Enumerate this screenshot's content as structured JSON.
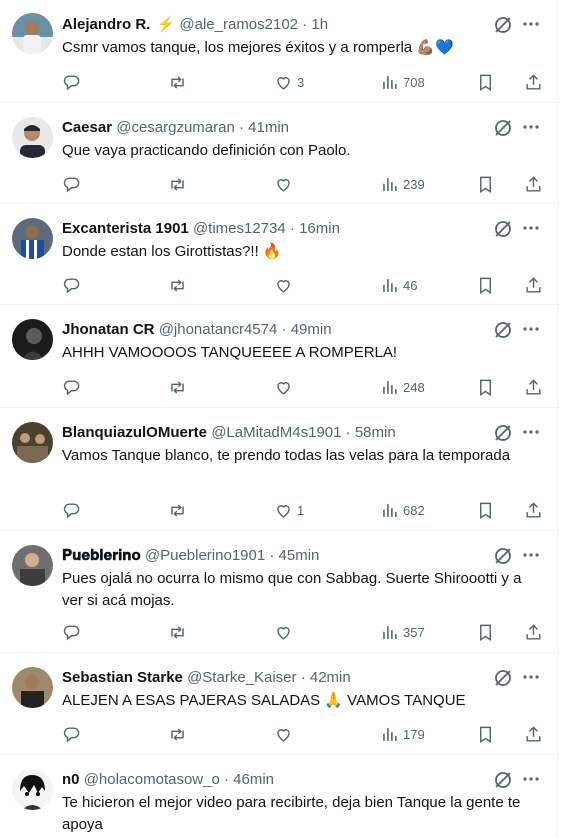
{
  "tweets": [
    {
      "name": "Alejandro R.",
      "badge": "⚡",
      "handle": "@ale_ramos2102",
      "dot": "·",
      "time": "1h",
      "text": "Csmr vamos tanque, los mejores éxitos y a romperla 💪🏽💙",
      "replies": "",
      "retweets": "",
      "likes": "3",
      "views": "708"
    },
    {
      "name": "Caesar",
      "handle": "@cesargzumaran",
      "dot": "·",
      "time": "41min",
      "text": "Que vaya practicando definición con Paolo.",
      "replies": "",
      "retweets": "",
      "likes": "",
      "views": "239"
    },
    {
      "name": "Excanterista 1901",
      "handle": "@times12734",
      "dot": "·",
      "time": "16min",
      "text": "Donde estan los Girottistas?!! 🔥",
      "replies": "",
      "retweets": "",
      "likes": "",
      "views": "46"
    },
    {
      "name": "Jhonatan CR",
      "handle": "@jhonatancr4574",
      "dot": "·",
      "time": "49min",
      "text": "AHHH VAMOOOOS TANQUEEEE A ROMPERLA!",
      "replies": "",
      "retweets": "",
      "likes": "",
      "views": "248"
    },
    {
      "name": "BlanquiazulOMuerte",
      "handle": "@LaMitadM4s1901",
      "dot": "·",
      "time": "58min",
      "text": "Vamos Tanque blanco, te prendo todas las velas para la temporada",
      "replies": "",
      "retweets": "",
      "likes": "1",
      "views": "682"
    },
    {
      "name": "𝐏𝐮𝐞𝐛𝐥𝐞𝐫𝐢𝐧𝐨",
      "handle": "@Pueblerino1901",
      "dot": "·",
      "time": "45min",
      "text": "Pues ojalá no ocurra lo mismo que con Sabbag. Suerte Shiroootti y a ver si acá mojas.",
      "replies": "",
      "retweets": "",
      "likes": "",
      "views": "357"
    },
    {
      "name": "Sebastian Starke",
      "handle": "@Starke_Kaiser",
      "dot": "·",
      "time": "42min",
      "text": "ALEJEN A ESAS PAJERAS SALADAS 🙏 VAMOS TANQUE",
      "replies": "",
      "retweets": "",
      "likes": "",
      "views": "179"
    },
    {
      "name": "n0",
      "handle": "@holacomotasow_o",
      "dot": "·",
      "time": "46min",
      "text": "Te hicieron el mejor video para recibirte, deja bien Tanque la gente te apoya",
      "replies": "",
      "retweets": "",
      "likes": "",
      "views": ""
    }
  ],
  "colors": {
    "text": "#0f1419",
    "secondary": "#536471",
    "divider": "#eff3f4"
  },
  "icons": {
    "reply": "reply-icon",
    "retweet": "retweet-icon",
    "like": "heart-icon",
    "views": "views-icon",
    "bookmark": "bookmark-icon",
    "share": "share-icon",
    "grok": "grok-icon",
    "more": "more-icon"
  }
}
